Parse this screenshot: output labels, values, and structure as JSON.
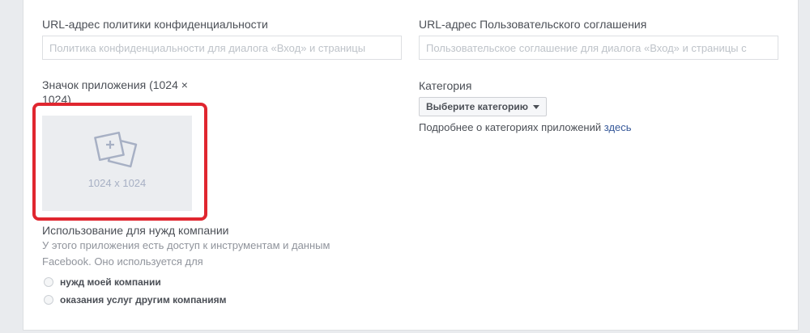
{
  "privacy": {
    "label": "URL-адрес политики конфиденциальности",
    "placeholder": "Политика конфиденциальности для диалога «Вход» и страницы",
    "value": ""
  },
  "terms": {
    "label": "URL-адрес Пользовательского соглашения",
    "placeholder": "Пользовательское соглашение для диалога «Вход» и страницы с",
    "value": ""
  },
  "app_icon": {
    "label_line1": "Значок приложения (1024 ×",
    "label_line2": "1024)",
    "size_text": "1024 x 1024",
    "icon": "image-upload-icon",
    "highlight_color": "#e0262f"
  },
  "category": {
    "label": "Категория",
    "select_label": "Выберите категорию",
    "help_text": "Подробнее о категориях приложений",
    "help_link": "здесь"
  },
  "business_use": {
    "label": "Использование для нужд компании",
    "description_line1": "У этого приложения есть доступ к инструментам и данным",
    "description_line2": "Facebook. Оно используется для",
    "options": [
      {
        "label": "нужд моей компании",
        "selected": false
      },
      {
        "label": "оказания услуг другим компаниям",
        "selected": false
      }
    ]
  }
}
